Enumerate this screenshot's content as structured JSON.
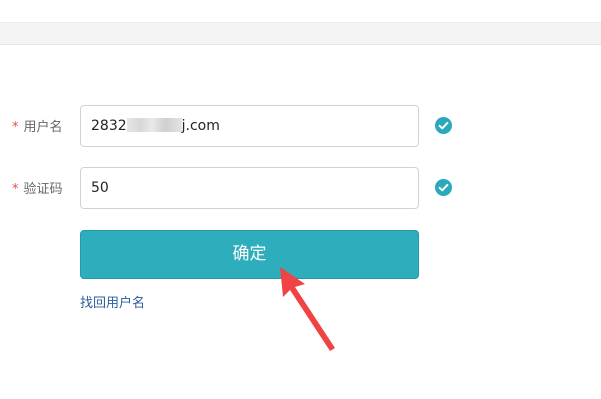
{
  "form": {
    "required_mark": "*",
    "username": {
      "label": "用户名",
      "value_prefix": "2832",
      "value_suffix": "j.com"
    },
    "captcha": {
      "label": "验证码",
      "value": "50"
    },
    "confirm_label": "确定",
    "recover_link": "找回用户名"
  },
  "colors": {
    "accent": "#2eaebd",
    "check_icon": "#2aa9bb",
    "required": "#e2504a",
    "link": "#2a5d9a",
    "annotation_arrow": "#f04444"
  },
  "icons": {
    "username_status": "check-circle-icon",
    "captcha_status": "check-circle-icon"
  }
}
